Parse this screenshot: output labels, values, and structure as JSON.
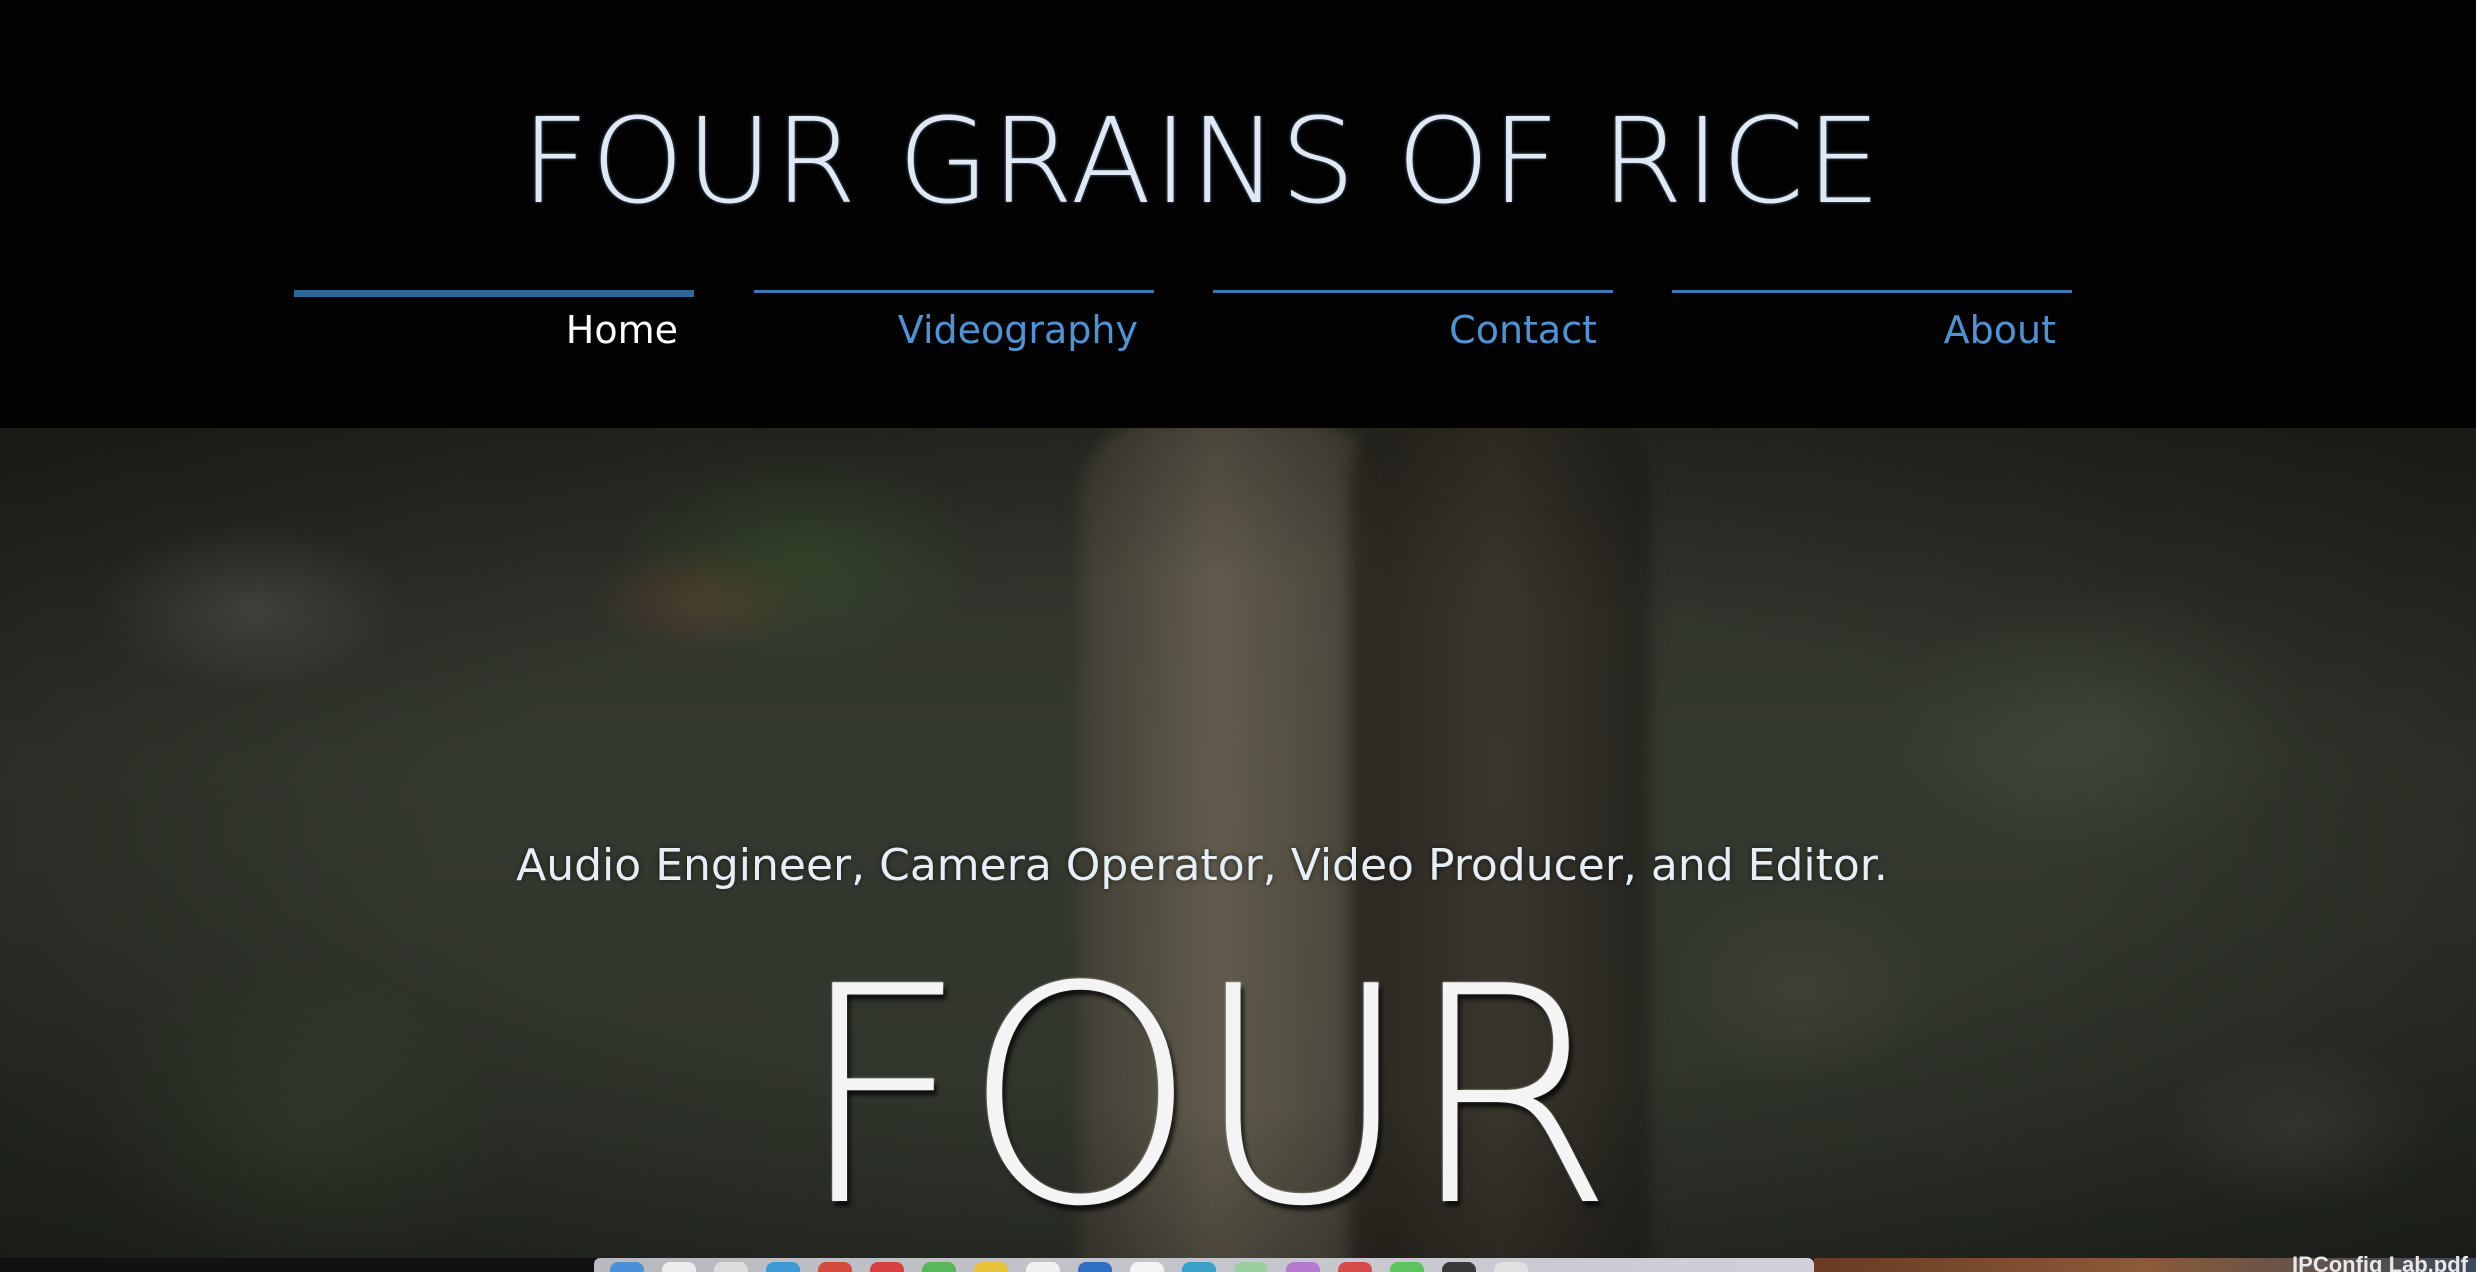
{
  "site": {
    "title": "FOUR GRAINS OF RICE"
  },
  "nav": {
    "items": [
      {
        "label": "Home",
        "active": true
      },
      {
        "label": "Videography",
        "active": false
      },
      {
        "label": "Contact",
        "active": false
      },
      {
        "label": "About",
        "active": false
      }
    ]
  },
  "hero": {
    "tagline": "Audio Engineer, Camera Operator, Video Producer, and Editor.",
    "big_word": "FOUR"
  },
  "desktop": {
    "file_label": "IPConfig Lab.pdf"
  },
  "colors": {
    "nav_link": "#4d94d6",
    "nav_active": "#ffffff",
    "nav_bar": "#3a78b4",
    "header_bg": "#020202"
  }
}
